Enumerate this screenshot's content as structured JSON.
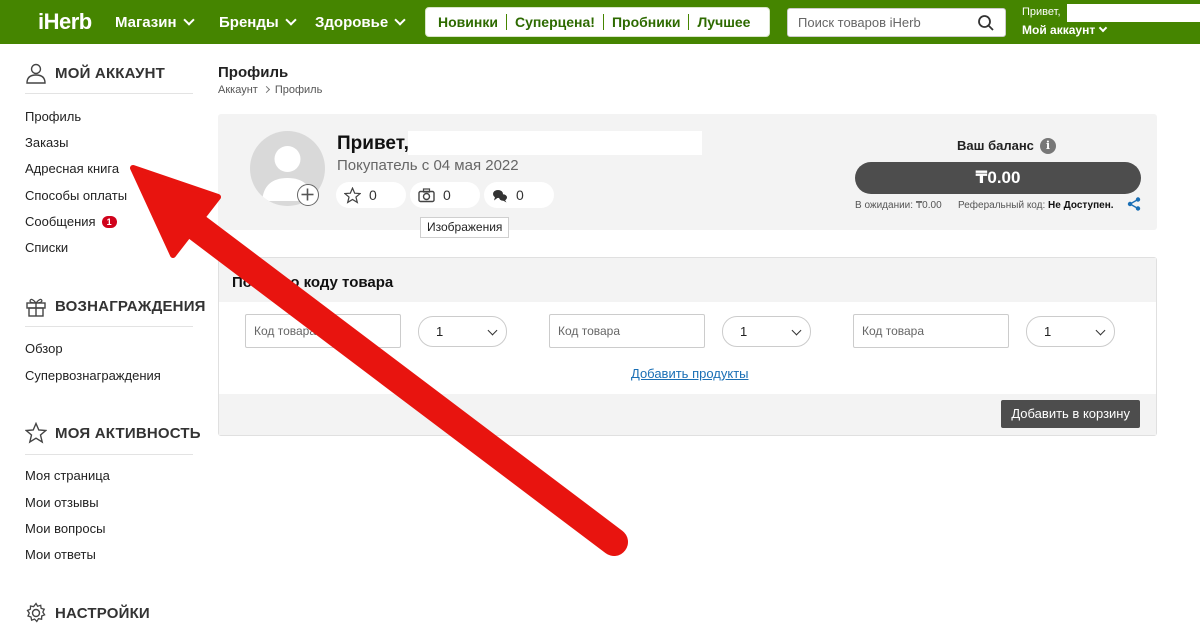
{
  "header": {
    "logo": "iHerb",
    "nav": [
      "Магазин",
      "Бренды",
      "Здоровье"
    ],
    "promo": [
      "Новинки",
      "Суперцена!",
      "Пробники",
      "Лучшее"
    ],
    "search_placeholder": "Поиск товаров iHerb",
    "greeting": "Привет,",
    "account_label": "Мой аккаунт"
  },
  "sidebar": {
    "account": {
      "title": "МОЙ АККАУНТ",
      "items": [
        "Профиль",
        "Заказы",
        "Адресная книга",
        "Способы оплаты",
        "Сообщения",
        "Списки"
      ],
      "messages_badge": "1"
    },
    "rewards": {
      "title": "ВОЗНАГРАЖДЕНИЯ",
      "items": [
        "Обзор",
        "Супервознаграждения"
      ]
    },
    "activity": {
      "title": "МОЯ АКТИВНОСТЬ",
      "items": [
        "Моя страница",
        "Мои отзывы",
        "Мои вопросы",
        "Мои ответы"
      ]
    },
    "settings": {
      "title": "НАСТРОЙКИ"
    }
  },
  "page": {
    "title": "Профиль",
    "breadcrumb": [
      "Аккаунт",
      "Профиль"
    ]
  },
  "profile": {
    "hello": "Привет,",
    "since": "Покупатель с 04 мая 2022",
    "stats": {
      "reviews": "0",
      "images": "0",
      "answers": "0"
    },
    "tooltip": "Изображения",
    "balance_label": "Ваш баланс",
    "balance": "₸0.00",
    "pending": "В ожидании: ₸0.00",
    "ref_label": "Реферальный код:",
    "ref_value": "Не Доступен."
  },
  "quick_order": {
    "title": "Поиск по коду товара",
    "code_placeholder": "Код товара",
    "qty": "1",
    "add_products": "Добавить продукты",
    "add_to_cart": "Добавить в корзину"
  },
  "colors": {
    "brand_green": "#458500",
    "annotation_arrow": "#e8140f"
  }
}
